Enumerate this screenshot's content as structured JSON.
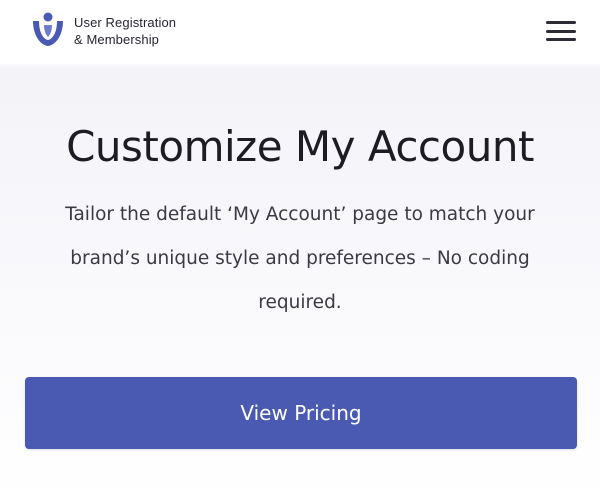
{
  "header": {
    "brand_line1": "User Registration",
    "brand_line2": "& Membership",
    "logo_icon": "user-registration-logo-icon",
    "menu_icon": "hamburger-menu-icon"
  },
  "hero": {
    "title": "Customize My Account",
    "description": "Tailor the default ‘My Account’ page to match your brand’s unique style and preferences – No coding required."
  },
  "cta": {
    "label": "View Pricing"
  },
  "colors": {
    "brand": "#4a5ab3",
    "text_dark": "#1c1c22",
    "text_muted": "#3a3a42"
  }
}
